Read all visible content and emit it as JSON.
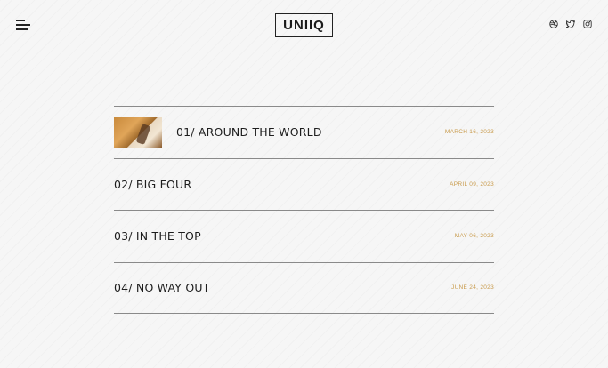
{
  "header": {
    "logo": "UNIIQ",
    "menu_icon": "hamburger-menu-icon",
    "social": [
      {
        "name": "dribbble",
        "icon": "dribbble-icon"
      },
      {
        "name": "twitter",
        "icon": "twitter-icon"
      },
      {
        "name": "instagram",
        "icon": "instagram-icon"
      }
    ]
  },
  "posts": [
    {
      "title": "01/ AROUND THE WORLD",
      "date": "MARCH 16, 2023",
      "has_image": true
    },
    {
      "title": "02/ BIG FOUR",
      "date": "APRIL 09, 2023",
      "has_image": false
    },
    {
      "title": "03/ IN THE TOP",
      "date": "MAY 06, 2023",
      "has_image": false
    },
    {
      "title": "04/ NO WAY OUT",
      "date": "JUNE 24, 2023",
      "has_image": false
    }
  ],
  "colors": {
    "accent": "#c89a4a",
    "text": "#1d1d1d",
    "background": "#f6f6f6",
    "divider": "#8a8a8a"
  }
}
